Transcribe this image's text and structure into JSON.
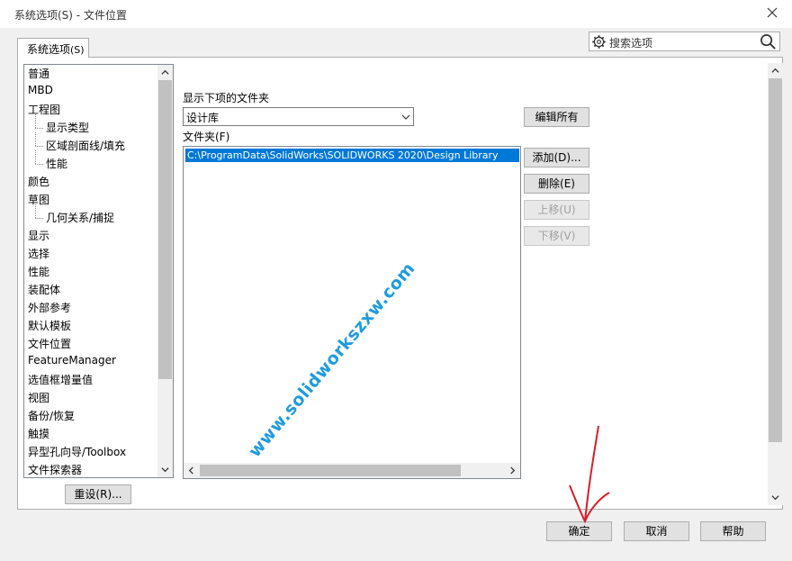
{
  "window": {
    "title": "系统选项(S) - 文件位置"
  },
  "tab": {
    "label": "系统选项",
    "mnemonic": "(S)"
  },
  "search": {
    "placeholder": "搜索选项"
  },
  "tree": {
    "items": [
      {
        "label": "普通",
        "level": 0
      },
      {
        "label": "MBD",
        "level": 0
      },
      {
        "label": "工程图",
        "level": 0
      },
      {
        "label": "显示类型",
        "level": 1
      },
      {
        "label": "区域剖面线/填充",
        "level": 1
      },
      {
        "label": "性能",
        "level": 1
      },
      {
        "label": "颜色",
        "level": 0
      },
      {
        "label": "草图",
        "level": 0
      },
      {
        "label": "几何关系/捕捉",
        "level": 1
      },
      {
        "label": "显示",
        "level": 0
      },
      {
        "label": "选择",
        "level": 0
      },
      {
        "label": "性能",
        "level": 0
      },
      {
        "label": "装配体",
        "level": 0
      },
      {
        "label": "外部参考",
        "level": 0
      },
      {
        "label": "默认模板",
        "level": 0
      },
      {
        "label": "文件位置",
        "level": 0
      },
      {
        "label": "FeatureManager",
        "level": 0
      },
      {
        "label": "选值框增量值",
        "level": 0
      },
      {
        "label": "视图",
        "level": 0
      },
      {
        "label": "备份/恢复",
        "level": 0
      },
      {
        "label": "触摸",
        "level": 0
      },
      {
        "label": "异型孔向导/Toolbox",
        "level": 0
      },
      {
        "label": "文件探索器",
        "level": 0
      }
    ]
  },
  "reset_button": "重设(R)...",
  "show_folders_label": "显示下项的文件夹",
  "show_folders_select": "设计库",
  "edit_all_button": "编辑所有",
  "folders_label": "文件夹(F)",
  "folders": [
    "C:\\ProgramData\\SolidWorks\\SOLIDWORKS 2020\\Design Library"
  ],
  "buttons": {
    "add": "添加(D)...",
    "delete": "删除(E)",
    "move_up": "上移(U)",
    "move_down": "下移(V)"
  },
  "footer": {
    "ok": "确定",
    "cancel": "取消",
    "help": "帮助"
  },
  "watermark": "www.solidworkszxw.com",
  "colors": {
    "selection": "#0078d7",
    "watermark": "#1e9be0",
    "annotation": "#d81e2a"
  },
  "icons": [
    "close-icon",
    "gear-icon",
    "search-icon",
    "chevron-down-icon",
    "arrow-up-icon",
    "arrow-down-icon",
    "arrow-left-icon",
    "arrow-right-icon"
  ]
}
